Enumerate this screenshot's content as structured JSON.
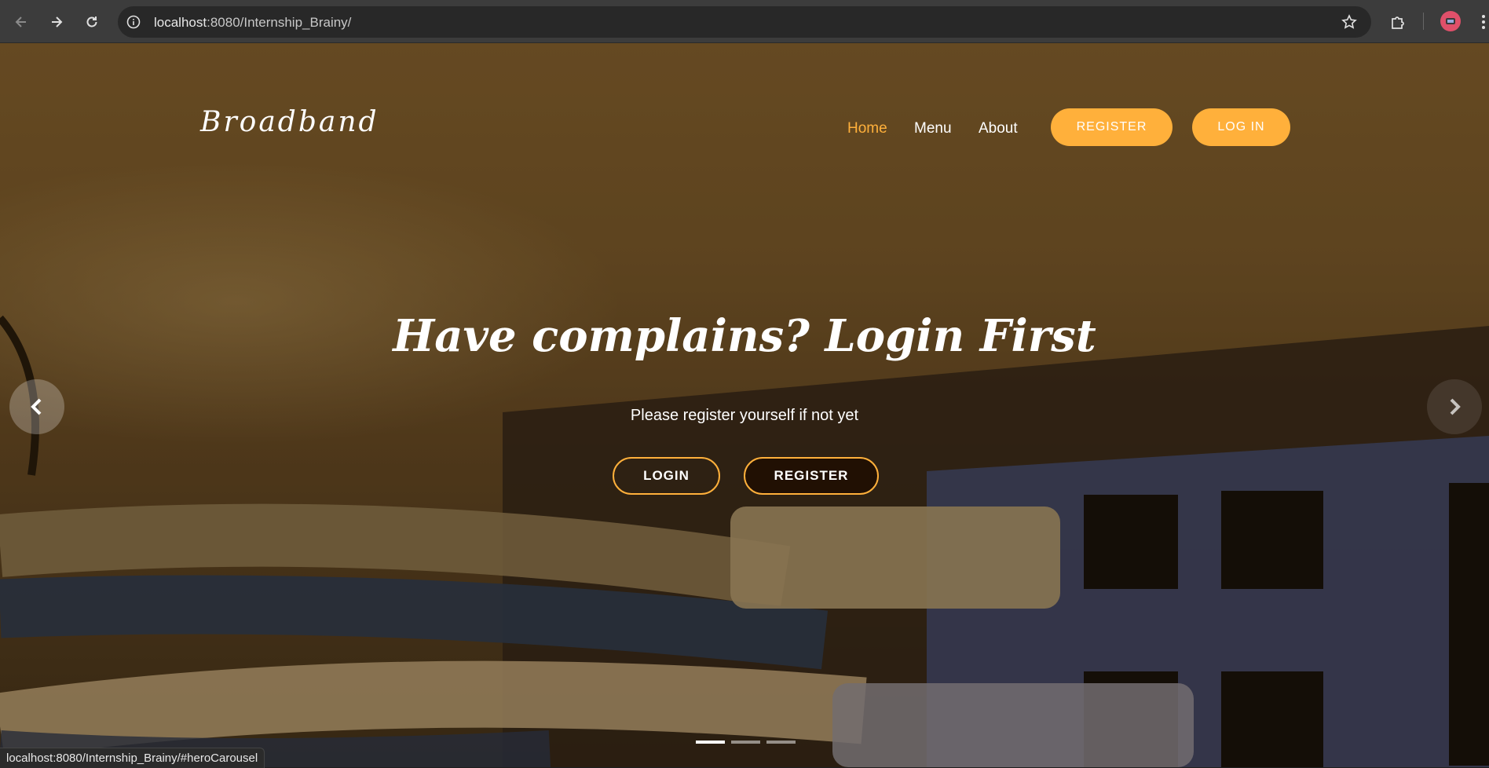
{
  "browser": {
    "url_host": "localhost",
    "url_rest": ":8080/Internship_Brainy/",
    "status_url": "localhost:8080/Internship_Brainy/#heroCarousel"
  },
  "navbar": {
    "brand": "Broadband",
    "links": [
      {
        "label": "Home",
        "active": true
      },
      {
        "label": "Menu",
        "active": false
      },
      {
        "label": "About",
        "active": false
      }
    ],
    "register_label": "REGISTER",
    "login_label": "LOG IN"
  },
  "hero": {
    "title": "Have complains? Login First",
    "subtitle": "Please register yourself if not yet",
    "login_button": "LOGIN",
    "register_button": "REGISTER",
    "slides_total": 3,
    "active_slide": 1
  },
  "colors": {
    "accent": "#ffb03b",
    "chrome_bg": "#3c3c3c",
    "omnibox_bg": "#282828"
  },
  "icons": [
    "back-arrow-icon",
    "forward-arrow-icon",
    "reload-icon",
    "site-info-icon",
    "bookmark-star-icon",
    "extensions-icon",
    "profile-avatar-icon",
    "more-menu-icon",
    "carousel-prev-icon",
    "carousel-next-icon"
  ]
}
